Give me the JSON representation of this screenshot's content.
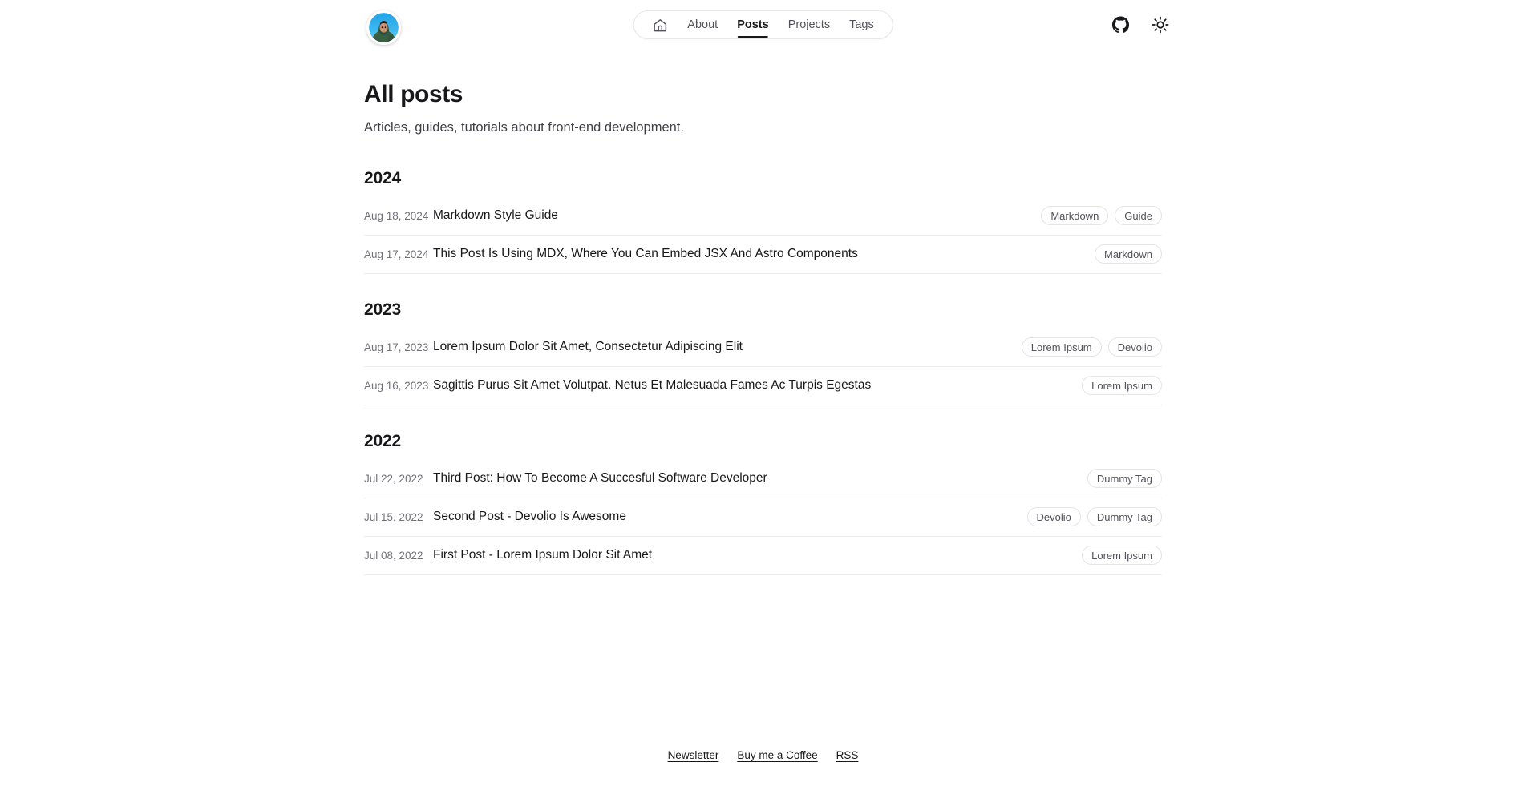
{
  "header": {
    "avatar": {
      "name": "avatar",
      "alt": "Profile photo of person in green jacket against blue sky"
    },
    "nav": {
      "home_icon": "home-icon",
      "items": [
        {
          "label": "About",
          "active": false
        },
        {
          "label": "Posts",
          "active": true
        },
        {
          "label": "Projects",
          "active": false
        },
        {
          "label": "Tags",
          "active": false
        }
      ]
    },
    "actions": [
      {
        "icon": "github-icon",
        "label": "GitHub"
      },
      {
        "icon": "sun-icon",
        "label": "Toggle theme"
      }
    ]
  },
  "main": {
    "title": "All posts",
    "subtitle": "Articles, guides, tutorials about front-end development.",
    "years": [
      {
        "year": "2024",
        "posts": [
          {
            "date": "Aug 18, 2024",
            "title": "Markdown Style Guide",
            "tags": [
              "Markdown",
              "Guide"
            ]
          },
          {
            "date": "Aug 17, 2024",
            "title": "This Post Is Using MDX, Where You Can Embed JSX And Astro Components",
            "tags": [
              "Markdown"
            ]
          }
        ]
      },
      {
        "year": "2023",
        "posts": [
          {
            "date": "Aug 17, 2023",
            "title": "Lorem Ipsum Dolor Sit Amet, Consectetur Adipiscing Elit",
            "tags": [
              "Lorem Ipsum",
              "Devolio"
            ]
          },
          {
            "date": "Aug 16, 2023",
            "title": "Sagittis Purus Sit Amet Volutpat. Netus Et Malesuada Fames Ac Turpis Egestas",
            "tags": [
              "Lorem Ipsum"
            ]
          }
        ]
      },
      {
        "year": "2022",
        "posts": [
          {
            "date": "Jul 22, 2022",
            "title": "Third Post: How To Become A Succesful Software Developer",
            "tags": [
              "Dummy Tag"
            ]
          },
          {
            "date": "Jul 15, 2022",
            "title": "Second Post - Devolio Is Awesome",
            "tags": [
              "Devolio",
              "Dummy Tag"
            ]
          },
          {
            "date": "Jul 08, 2022",
            "title": "First Post - Lorem Ipsum Dolor Sit Amet",
            "tags": [
              "Lorem Ipsum"
            ]
          }
        ]
      }
    ]
  },
  "footer": {
    "links": [
      {
        "label": "Newsletter"
      },
      {
        "label": "Buy me a Coffee"
      },
      {
        "label": "RSS"
      }
    ]
  },
  "colors": {
    "background": "#ffffff",
    "text": "#18181b",
    "muted": "#71717a",
    "border": "#e4e4e7",
    "divider": "#ececef"
  }
}
